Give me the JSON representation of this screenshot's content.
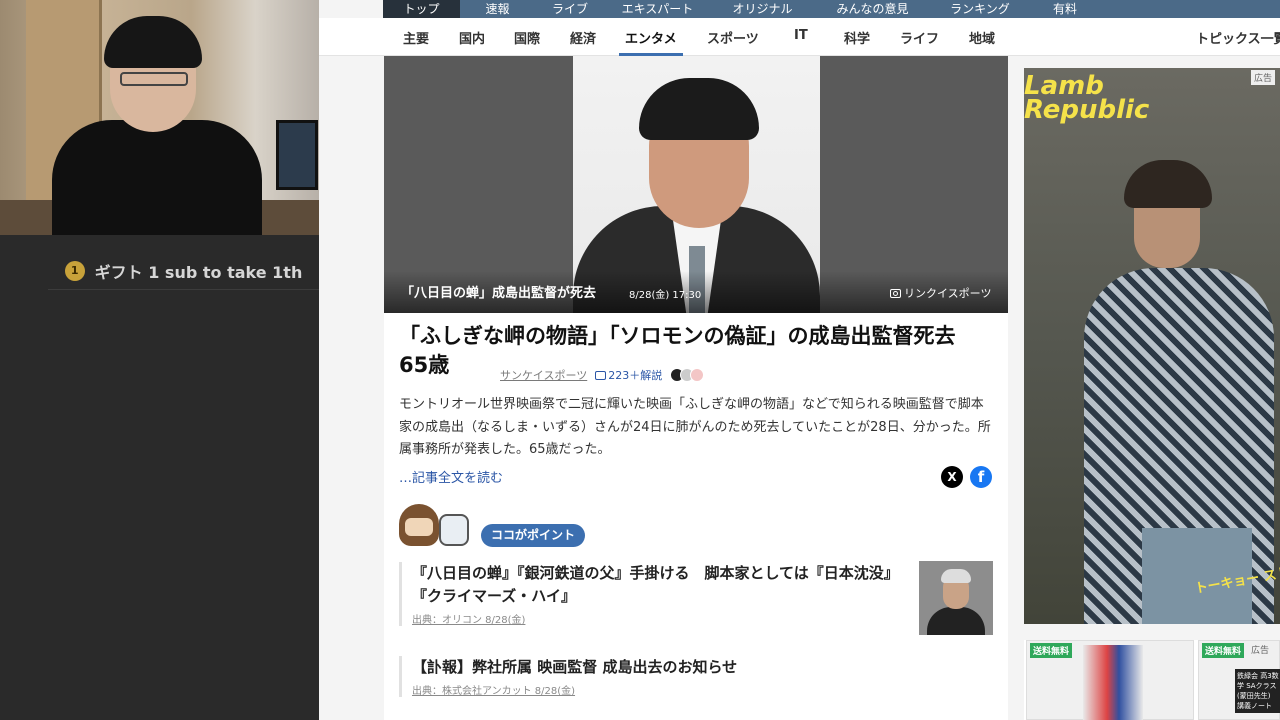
{
  "stream": {
    "gift_badge": "1",
    "gift_text": "ギフト 1 sub to take 1th"
  },
  "top_nav": {
    "tabs": [
      "トップ",
      "速報",
      "ライブ",
      "エキスパート",
      "オリジナル",
      "みんなの意見",
      "ランキング",
      "有料"
    ]
  },
  "category_nav": {
    "items": [
      "主要",
      "国内",
      "国際",
      "経済",
      "エンタメ",
      "スポーツ",
      "IT",
      "科学",
      "ライフ",
      "地域"
    ],
    "active": "エンタメ",
    "topics": "トピックス一覧"
  },
  "hero": {
    "caption": "「八日目の蝉」成島出監督が死去",
    "time": "8/28(金) 17:30",
    "credit": "リンクイスポーツ"
  },
  "article": {
    "headline": "「ふしぎな岬の物語」「ソロモンの偽証」の成島出監督死去　65歳",
    "source": "サンケイスポーツ",
    "comments": "223＋解説",
    "summary": "モントリオール世界映画祭で二冠に輝いた映画「ふしぎな岬の物語」などで知られる映画監督で脚本家の成島出（なるしま・いずる）さんが24日に肺がんのため死去していたことが28日、分かった。所属事務所が発表した。65歳だった。",
    "read_more": "…記事全文を読む",
    "share_x": "X",
    "share_fb": "f"
  },
  "points": {
    "pill": "ココがポイント",
    "items": [
      {
        "title": "『八日目の蝉』『銀河鉄道の父』手掛ける　脚本家としては『日本沈没』『クライマーズ・ハイ』",
        "source": "出典：オリコン 8/28(金)"
      },
      {
        "title": "【訃報】弊社所属 映画監督 成島出去のお知らせ",
        "source": "出典：株式会社アンカット 8/28(金)"
      }
    ]
  },
  "ads": {
    "brand": "Lamb Republic",
    "label": "広告",
    "tagline": "トーキョー ストリートスタ",
    "product_tag_1": "送料無料",
    "product_tag_2": "送料無料",
    "product_2_label": "広告",
    "product_2_text": "鉄緑会 高3数学 SAクラス(蒙田先生) 講義ノート"
  },
  "colors": {
    "accent": "#3c6fb0",
    "top_nav_bg": "#4b6a88",
    "link": "#2b56a6"
  }
}
